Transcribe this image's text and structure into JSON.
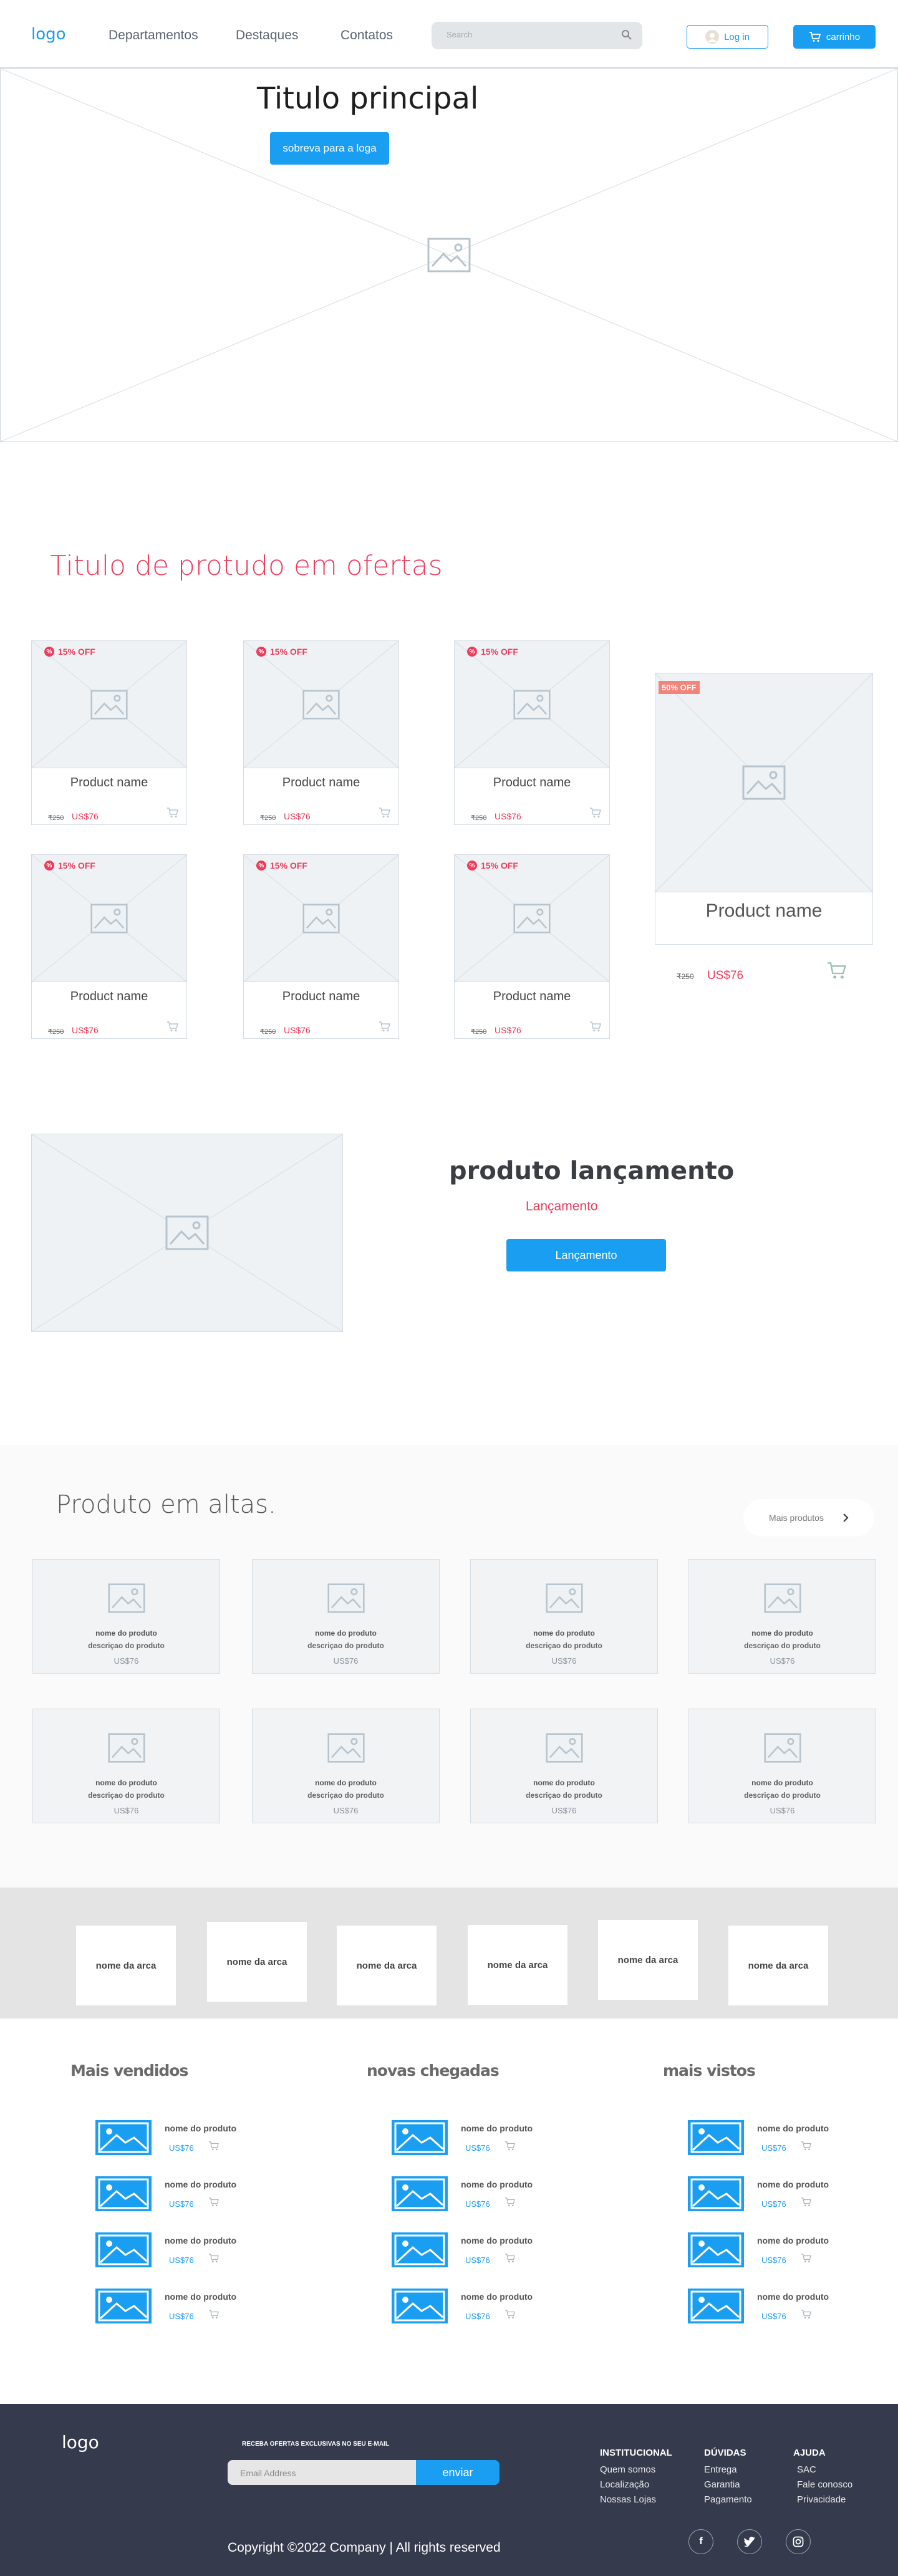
{
  "header": {
    "logo": "logo",
    "nav": [
      "Departamentos",
      "Destaques",
      "Contatos"
    ],
    "search_placeholder": "Search",
    "login": "Log in",
    "cart": "carrinho"
  },
  "hero": {
    "title": "Titulo principal",
    "button": "sobreva para a loga"
  },
  "offers": {
    "title": "Titulo de protudo em ofertas",
    "cards": [
      {
        "badge": "15% OFF",
        "name": "Product name",
        "old": "₹250",
        "price": "US$76"
      },
      {
        "badge": "15% OFF",
        "name": "Product name",
        "old": "₹250",
        "price": "US$76"
      },
      {
        "badge": "15% OFF",
        "name": "Product name",
        "old": "₹250",
        "price": "US$76"
      },
      {
        "badge": "15% OFF",
        "name": "Product name",
        "old": "₹250",
        "price": "US$76"
      },
      {
        "badge": "15% OFF",
        "name": "Product name",
        "old": "₹250",
        "price": "US$76"
      },
      {
        "badge": "15% OFF",
        "name": "Product name",
        "old": "₹250",
        "price": "US$76"
      }
    ],
    "featured": {
      "badge": "50% OFF",
      "name": "Product name",
      "old": "₹250",
      "price": "US$76"
    }
  },
  "launch": {
    "title": "produto lançamento",
    "subtitle": "Lançamento",
    "button": "Lançamento"
  },
  "trending": {
    "title": "Produto em altas.",
    "more": "Mais produtos",
    "item": {
      "name": "nome do produto",
      "desc": "descriçao do produto",
      "price": "US$76"
    },
    "count": 8
  },
  "brands": [
    "nome da arca",
    "nome da arca",
    "nome da arca",
    "nome da arca",
    "nome da arca",
    "nome da arca"
  ],
  "lists": {
    "titles": [
      "Mais vendidos",
      "novas chegadas",
      "mais vistos"
    ],
    "item": {
      "name": "nome do produto",
      "price": "US$76"
    }
  },
  "footer": {
    "logo": "logo",
    "newsletter": "RECEBA OFERTAS EXCLUSIVAS NO SEU E-MAIL",
    "email_placeholder": "Email Address",
    "send": "enviar",
    "cols": [
      {
        "title": "INSTITUCIONAL",
        "links": [
          "Quem somos",
          "Localização",
          "Nossas Lojas"
        ]
      },
      {
        "title": "DÚVIDAS",
        "links": [
          "Entrega",
          "Garantia",
          "Pagamento"
        ]
      },
      {
        "title": "AJUDA",
        "links": [
          "SAC",
          "Fale conosco",
          "Privacidade"
        ]
      }
    ],
    "copyright": "Copyright ©2022 Company | All rights reserved",
    "social": [
      "f",
      "t",
      "ig"
    ]
  },
  "colors": {
    "accent": "#1a9ef1",
    "sale": "#f03a5a",
    "footer": "#363a4d"
  }
}
